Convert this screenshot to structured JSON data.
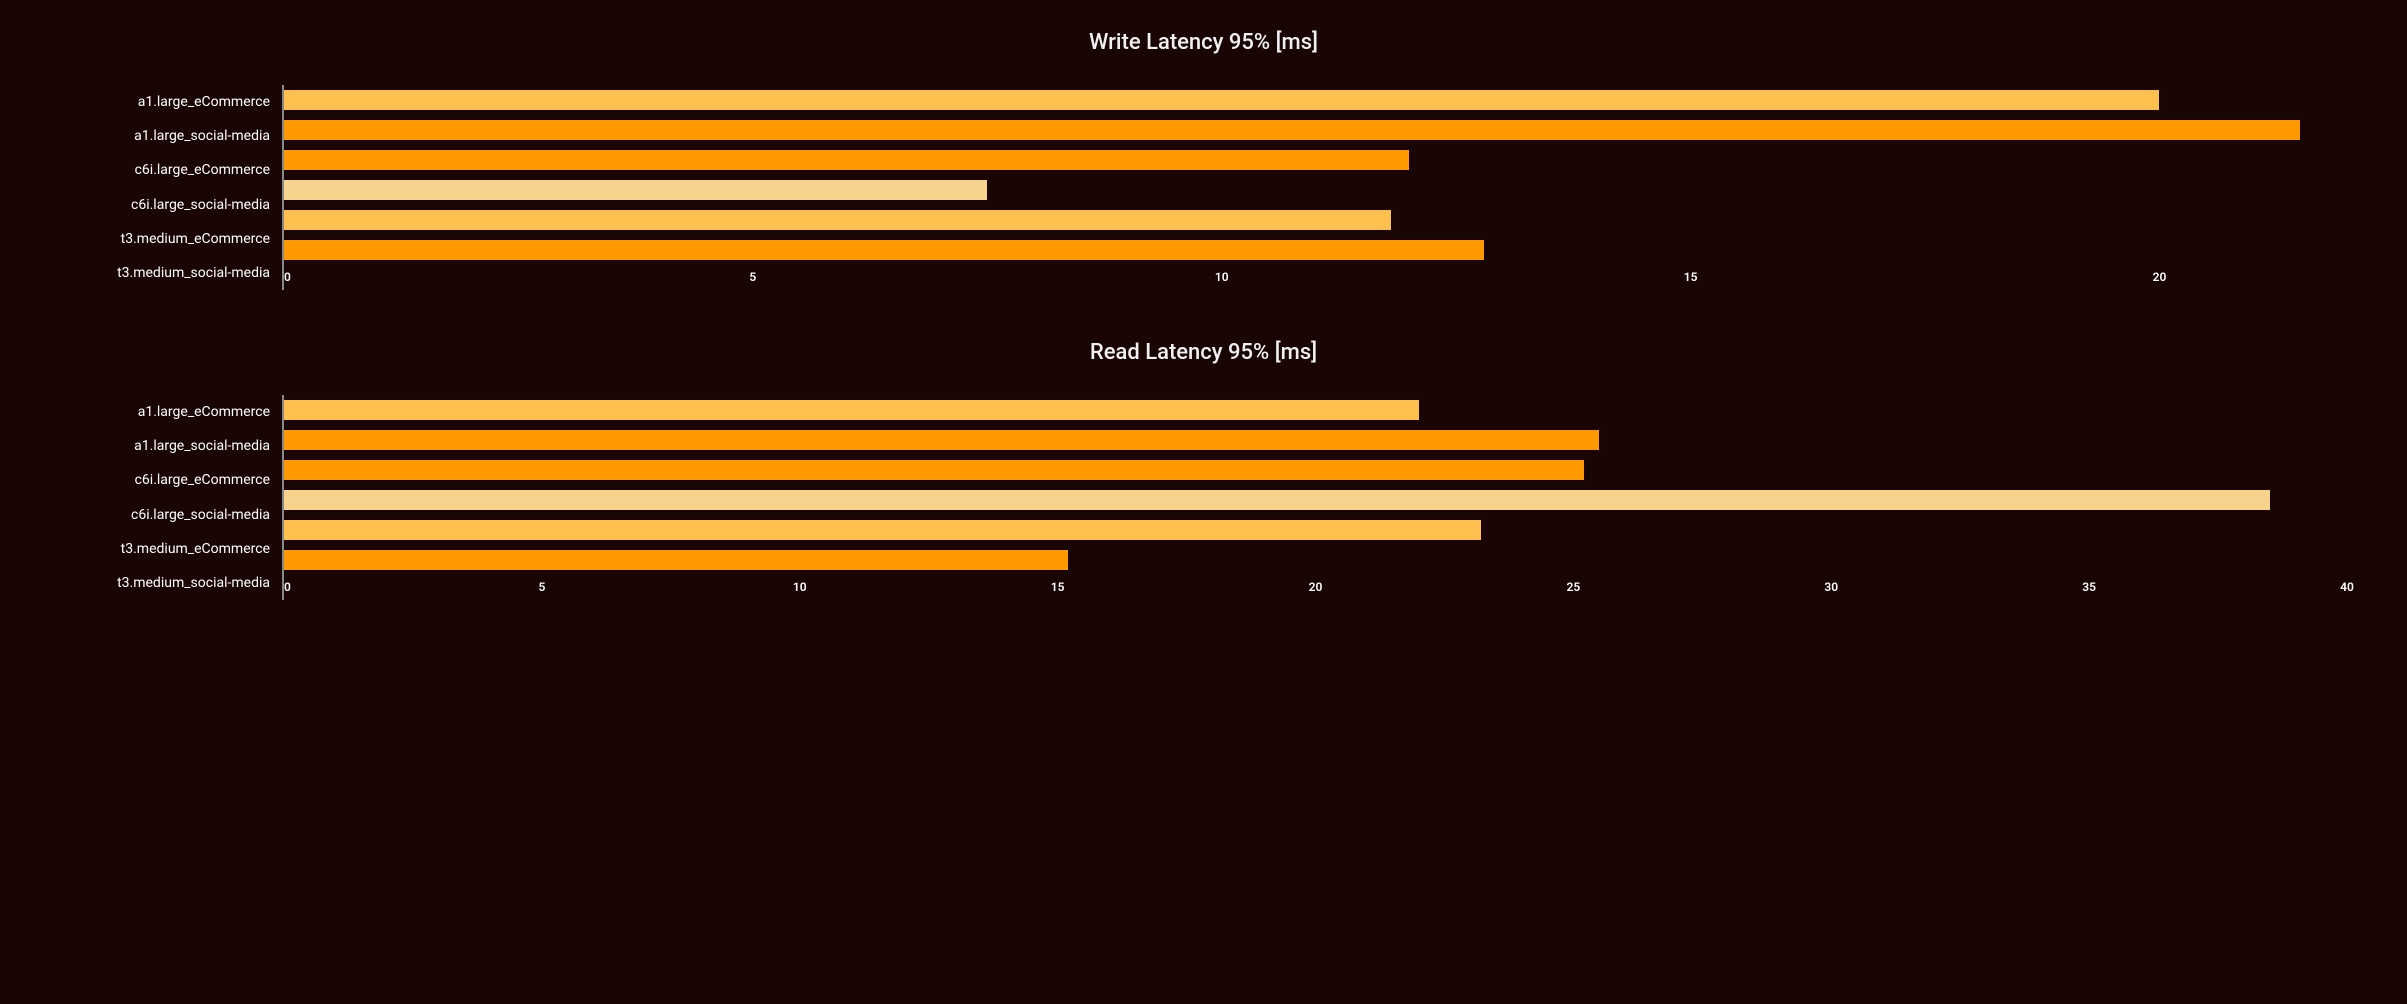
{
  "chart_data": [
    {
      "type": "bar",
      "orientation": "horizontal",
      "title": "Write Latency 95% [ms]",
      "xlabel": "",
      "ylabel": "",
      "xlim": [
        0,
        22
      ],
      "x_ticks": [
        0,
        5,
        10,
        15,
        20
      ],
      "categories": [
        "a1.large_eCommerce",
        "a1.large_social-media",
        "c6i.large_eCommerce",
        "c6i.large_social-media",
        "t3.medium_eCommerce",
        "t3.medium_social-media"
      ],
      "values": [
        20.0,
        21.5,
        12.0,
        7.5,
        11.8,
        12.8
      ],
      "colors": [
        "#FFC04D",
        "#FF9900",
        "#FF9900",
        "#F7D28C",
        "#FFC04D",
        "#FF9900"
      ]
    },
    {
      "type": "bar",
      "orientation": "horizontal",
      "title": "Read Latency 95% [ms]",
      "xlabel": "",
      "ylabel": "",
      "xlim": [
        0,
        40
      ],
      "x_ticks": [
        0,
        5,
        10,
        15,
        20,
        25,
        30,
        35,
        40
      ],
      "categories": [
        "a1.large_eCommerce",
        "a1.large_social-media",
        "c6i.large_eCommerce",
        "c6i.large_social-media",
        "t3.medium_eCommerce",
        "t3.medium_social-media"
      ],
      "values": [
        22.0,
        25.5,
        25.2,
        38.5,
        23.2,
        15.2
      ],
      "colors": [
        "#FFC04D",
        "#FF9900",
        "#FF9900",
        "#F7D28C",
        "#FFC04D",
        "#FF9900"
      ]
    }
  ]
}
